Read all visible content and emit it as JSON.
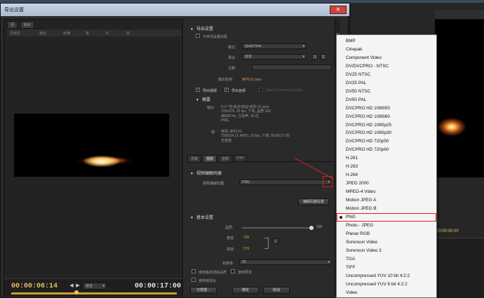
{
  "dialog": {
    "title": "导出设置",
    "close_label": "✕"
  },
  "left": {
    "source_tabs": [
      "源",
      "输出"
    ],
    "tool_labels": [
      "源缩放",
      "裁剪",
      "纵横",
      "宽",
      "长",
      "高"
    ],
    "current_time": "00:00:06:14",
    "fit_label": "适合",
    "duration": "00:00:17:00"
  },
  "export_settings": {
    "section": "导出设置",
    "match_sequence": "与序列设置匹配",
    "format_label": "格式:",
    "format_value": "QuickTime",
    "preset_label": "预设:",
    "preset_value": "自定",
    "comment_label": "注释:",
    "output_name_label": "输出名称:",
    "output_name_value": "序列 01.mov",
    "export_video": "导出视频",
    "export_audio": "导出音频",
    "open_in_device": "Open in Device Central",
    "summary_title": "摘要",
    "output_label": "输出:",
    "output_lines": [
      "D:\\广告\\高光\\地址\\序列 01.mov",
      "720x576, 25 fps, 下场, 品质 100",
      "48000 Hz, 立体声, 16 位",
      "PNG"
    ],
    "source_label": "源:",
    "source_lines": [
      "序列, 序列 01",
      "720x576 (1.4587), 25 fps, 下场, 00:00:17:00",
      "无音频"
    ]
  },
  "tabs": [
    "滤镜",
    "视频",
    "音频",
    "FTP"
  ],
  "video_codec": {
    "section": "视频编解码器",
    "codec_label": "视频编解码器:",
    "codec_value": "PNG",
    "codec_settings_button": "编解码器设置"
  },
  "basic": {
    "section": "基本设置",
    "quality_label": "品质:",
    "quality_value": "100",
    "width_label": "宽度:",
    "width_value": "720",
    "height_label": "高度:",
    "height_value": "576",
    "fps_label": "帧速率:",
    "fps_value": "25",
    "max_render": "使用最高渲染品质",
    "use_preview": "使用预览",
    "use_blend": "使用帧混合"
  },
  "bottom_buttons": [
    "元数据...",
    "确定",
    "取消"
  ],
  "background": {
    "timecode": "00:00:00:00"
  },
  "codec_options": [
    {
      "label": "BMP"
    },
    {
      "label": "Cinepak"
    },
    {
      "label": "Component Video"
    },
    {
      "label": "DV/DVCPRO - NTSC"
    },
    {
      "label": "DV25 NTSC"
    },
    {
      "label": "DV25 PAL"
    },
    {
      "label": "DV50 NTSC"
    },
    {
      "label": "DV50 PAL"
    },
    {
      "label": "DVCPRO HD 1080i50"
    },
    {
      "label": "DVCPRO HD 1080i60"
    },
    {
      "label": "DVCPRO HD 1080p25"
    },
    {
      "label": "DVCPRO HD 1080p30"
    },
    {
      "label": "DVCPRO HD 720p50"
    },
    {
      "label": "DVCPRO HD 720p60"
    },
    {
      "label": "H.261"
    },
    {
      "label": "H.263"
    },
    {
      "label": "H.264"
    },
    {
      "label": "JPEG 2000"
    },
    {
      "label": "MPEG-4 Video"
    },
    {
      "label": "Motion JPEG A"
    },
    {
      "label": "Motion JPEG B"
    },
    {
      "label": "PNG",
      "selected": true
    },
    {
      "label": "Photo - JPEG"
    },
    {
      "label": "Planar RGB"
    },
    {
      "label": "Sorenson Video"
    },
    {
      "label": "Sorenson Video 3"
    },
    {
      "label": "TGA"
    },
    {
      "label": "TIFF"
    },
    {
      "label": "Uncompressed YUV 10 bit 4:2:2"
    },
    {
      "label": "Uncompressed YUV 8 bit 4:2:2"
    },
    {
      "label": "Video"
    }
  ],
  "colors": {
    "accent_gold": "#e7c060",
    "highlight_red": "#e02020",
    "panel_bg": "#2b2b2b"
  }
}
